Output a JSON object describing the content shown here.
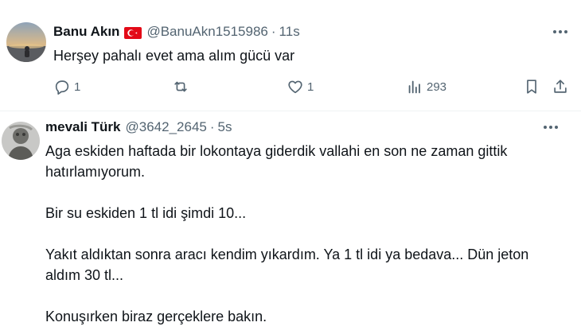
{
  "tweets": [
    {
      "display_name": "Banu Akın",
      "flag_icon": "turkey-flag-icon",
      "handle": "@BanuAkn1515986",
      "separator": "·",
      "time": "11s",
      "more_icon": "more-horizontal-icon",
      "text_lines": [
        "Herşey pahalı evet ama alım gücü var"
      ],
      "actions": {
        "reply_count": "1",
        "retweet_count": "",
        "like_count": "1",
        "view_count": "293"
      }
    },
    {
      "display_name": "mevali Türk",
      "handle": "@3642_2645",
      "separator": "·",
      "time": "5s",
      "more_icon": "more-horizontal-icon",
      "text_lines": [
        "Aga eskiden haftada bir lokontaya giderdik vallahi en son ne zaman gittik",
        "hatırlamıyorum.",
        "",
        "Bir su eskiden 1 tl idi şimdi 10...",
        "",
        "Yakıt aldıktan sonra aracı kendim yıkardım. Ya 1 tl idi ya bedava... Dün jeton",
        "aldım 30 tl...",
        "",
        "Konuşırken biraz gerçeklere bakın."
      ]
    }
  ],
  "colors": {
    "text_primary": "#0f1419",
    "text_secondary": "#536471",
    "divider": "#eff3f4",
    "flag_red": "#e30a17"
  }
}
